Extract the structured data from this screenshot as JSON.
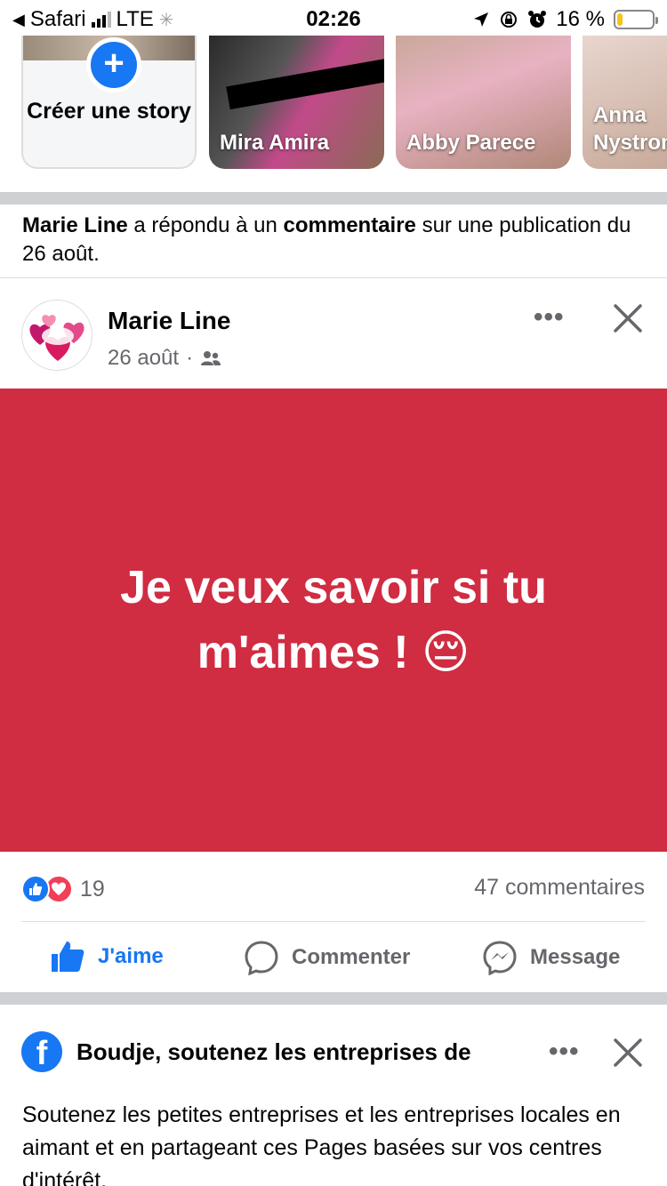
{
  "status_bar": {
    "back_app": "Safari",
    "carrier": "LTE",
    "time": "02:26",
    "battery": "16 %",
    "battery_level": 0.16
  },
  "stories": {
    "create_label": "Créer une story",
    "items": [
      {
        "name": "Mira Amira"
      },
      {
        "name": "Abby Parece"
      },
      {
        "name": "Anna Nystrom"
      }
    ]
  },
  "notice": {
    "actor": "Marie Line",
    "text_mid": " a répondu à un ",
    "object": "commentaire",
    "text_end": " sur une publication du 26 août."
  },
  "post": {
    "author": "Marie Line",
    "date": "26 août",
    "audience_icon": "friends-icon",
    "text": "Je veux savoir si tu m'aimes ! 😔",
    "background_color": "#d02c42",
    "reaction_count": "19",
    "comments_label": "47 commentaires",
    "actions": {
      "like": "J'aime",
      "comment": "Commenter",
      "message": "Message"
    }
  },
  "suggestion": {
    "title": "Boudje, soutenez les entreprises de",
    "body": "Soutenez les petites entreprises et les entreprises locales en aimant et en partageant ces Pages basées sur vos centres d'intérêt."
  },
  "colors": {
    "accent": "#1877f2",
    "love": "#f33e58",
    "muted": "#65676b"
  }
}
